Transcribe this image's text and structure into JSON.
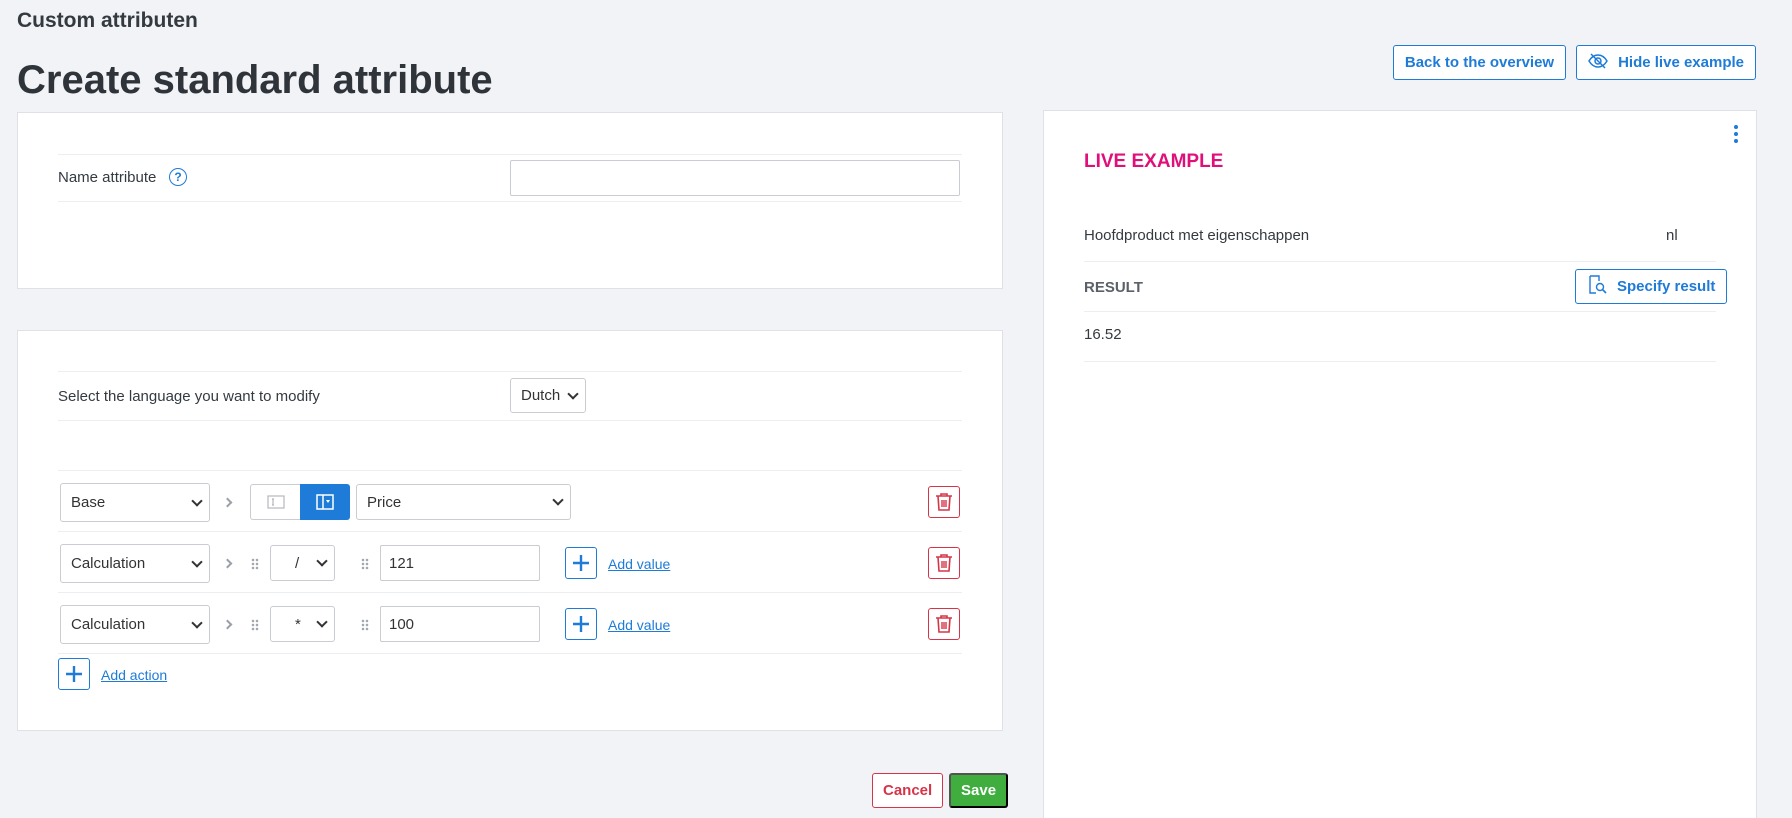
{
  "header": {
    "breadcrumb": "Custom attributen",
    "title": "Create standard attribute",
    "back_label": "Back to the overview",
    "hide_live_label": "Hide live example"
  },
  "name_section": {
    "label": "Name attribute",
    "help": "?",
    "value": "",
    "placeholder": ""
  },
  "language_section": {
    "label": "Select the language you want to modify",
    "selected": "Dutch"
  },
  "rules": [
    {
      "type": "Base",
      "field": "Price"
    },
    {
      "type": "Calculation",
      "operator": "/",
      "value": "121",
      "add_value_label": "Add value"
    },
    {
      "type": "Calculation",
      "operator": "*",
      "value": "100",
      "add_value_label": "Add value"
    }
  ],
  "add_action_label": "Add action",
  "footer": {
    "cancel_label": "Cancel",
    "save_label": "Save"
  },
  "live": {
    "title": "LIVE EXAMPLE",
    "product": "Hoofdproduct met eigenschappen",
    "lang": "nl",
    "result_label": "RESULT",
    "specify_label": "Specify result",
    "result_value": "16.52"
  },
  "colors": {
    "accent": "#1e7bd7",
    "danger": "#d63549",
    "success": "#3fae3f",
    "live_title": "#e0107a"
  }
}
